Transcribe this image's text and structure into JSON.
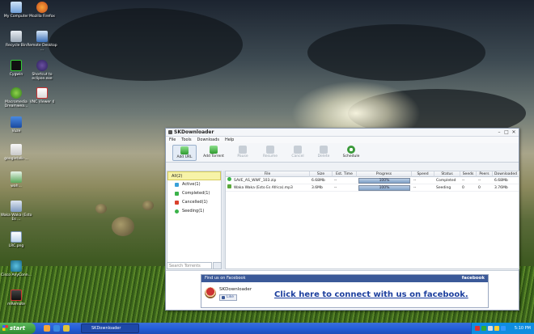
{
  "desktop": {
    "icons": [
      "My Computer",
      "Mozilla Firefox",
      "Recycle Bin",
      "Remote Desktop ...",
      "Cygwin",
      "Shortcut to eclipse.exe",
      "Macromedia Dreamwea...",
      "VNC Viewer 4",
      "Vuze",
      "googletalk-...",
      "wah...",
      "Waka Waka (Esto Es ...",
      "LRC.png",
      "Cisco AnyConn...",
      "mRemote"
    ]
  },
  "taskbar": {
    "start_label": "start",
    "task_label": "SKDownloader",
    "clock": "5:10 PM"
  },
  "window": {
    "title": "SKDownloader",
    "controls": [
      "–",
      "□",
      "✕"
    ],
    "menu": [
      "File",
      "Tools",
      "Downloads",
      "Help"
    ],
    "toolbar": [
      {
        "label": "Add URL",
        "icon": "add-url-icon",
        "enabled": true,
        "selected": true
      },
      {
        "label": "Add Torrent",
        "icon": "add-torrent-icon",
        "enabled": true,
        "selected": false
      },
      {
        "label": "Pause",
        "icon": "pause-icon",
        "enabled": false,
        "selected": false
      },
      {
        "label": "Resume",
        "icon": "resume-icon",
        "enabled": false,
        "selected": false
      },
      {
        "label": "Cancel",
        "icon": "cancel-icon",
        "enabled": false,
        "selected": false
      },
      {
        "label": "Delete",
        "icon": "delete-icon",
        "enabled": false,
        "selected": false
      },
      {
        "label": "Schedule",
        "icon": "schedule-icon",
        "enabled": true,
        "selected": false
      }
    ],
    "sidebar": {
      "items": [
        {
          "label": "All(2)",
          "selected": true,
          "color": "#5a7fbf"
        },
        {
          "label": "Active(1)",
          "selected": false,
          "color": "#3aa0d8"
        },
        {
          "label": "Completed(1)",
          "selected": false,
          "color": "#3bb34a"
        },
        {
          "label": "Cancelled(1)",
          "selected": false,
          "color": "#d9412c"
        },
        {
          "label": "Seeding(1)",
          "selected": false,
          "color": "#3bb34a"
        }
      ],
      "search_placeholder": "Search Torrents"
    },
    "table": {
      "columns": [
        "File",
        "Size",
        "Est. Time",
        "Progress",
        "Speed",
        "Status",
        "Seeds",
        "Peers",
        "Downloaded"
      ],
      "rows": [
        {
          "file": "SAVE_AS_WWF_103.zip",
          "size": "6.68Mb",
          "est_time": "--",
          "progress": 100,
          "progress_label": "100%",
          "speed": "--",
          "status": "Completed",
          "seeds": "--",
          "peers": "--",
          "downloaded": "6.68Mb",
          "icon_color": "#3bb34a"
        },
        {
          "file": "Waka Waka (Esto Es Africa).mp3",
          "size": "3.6Mb",
          "est_time": "--",
          "progress": 100,
          "progress_label": "100%",
          "speed": "--",
          "status": "Seeding",
          "seeds": "0",
          "peers": "0",
          "downloaded": "3.76Mb",
          "icon_color": "#5aa83a"
        }
      ]
    },
    "facebook": {
      "header": "Find us on Facebook",
      "brand": "facebook",
      "page_name": "SKDownloader",
      "like_label": "Like",
      "link_text": "Click here to connect with us on facebook."
    }
  }
}
